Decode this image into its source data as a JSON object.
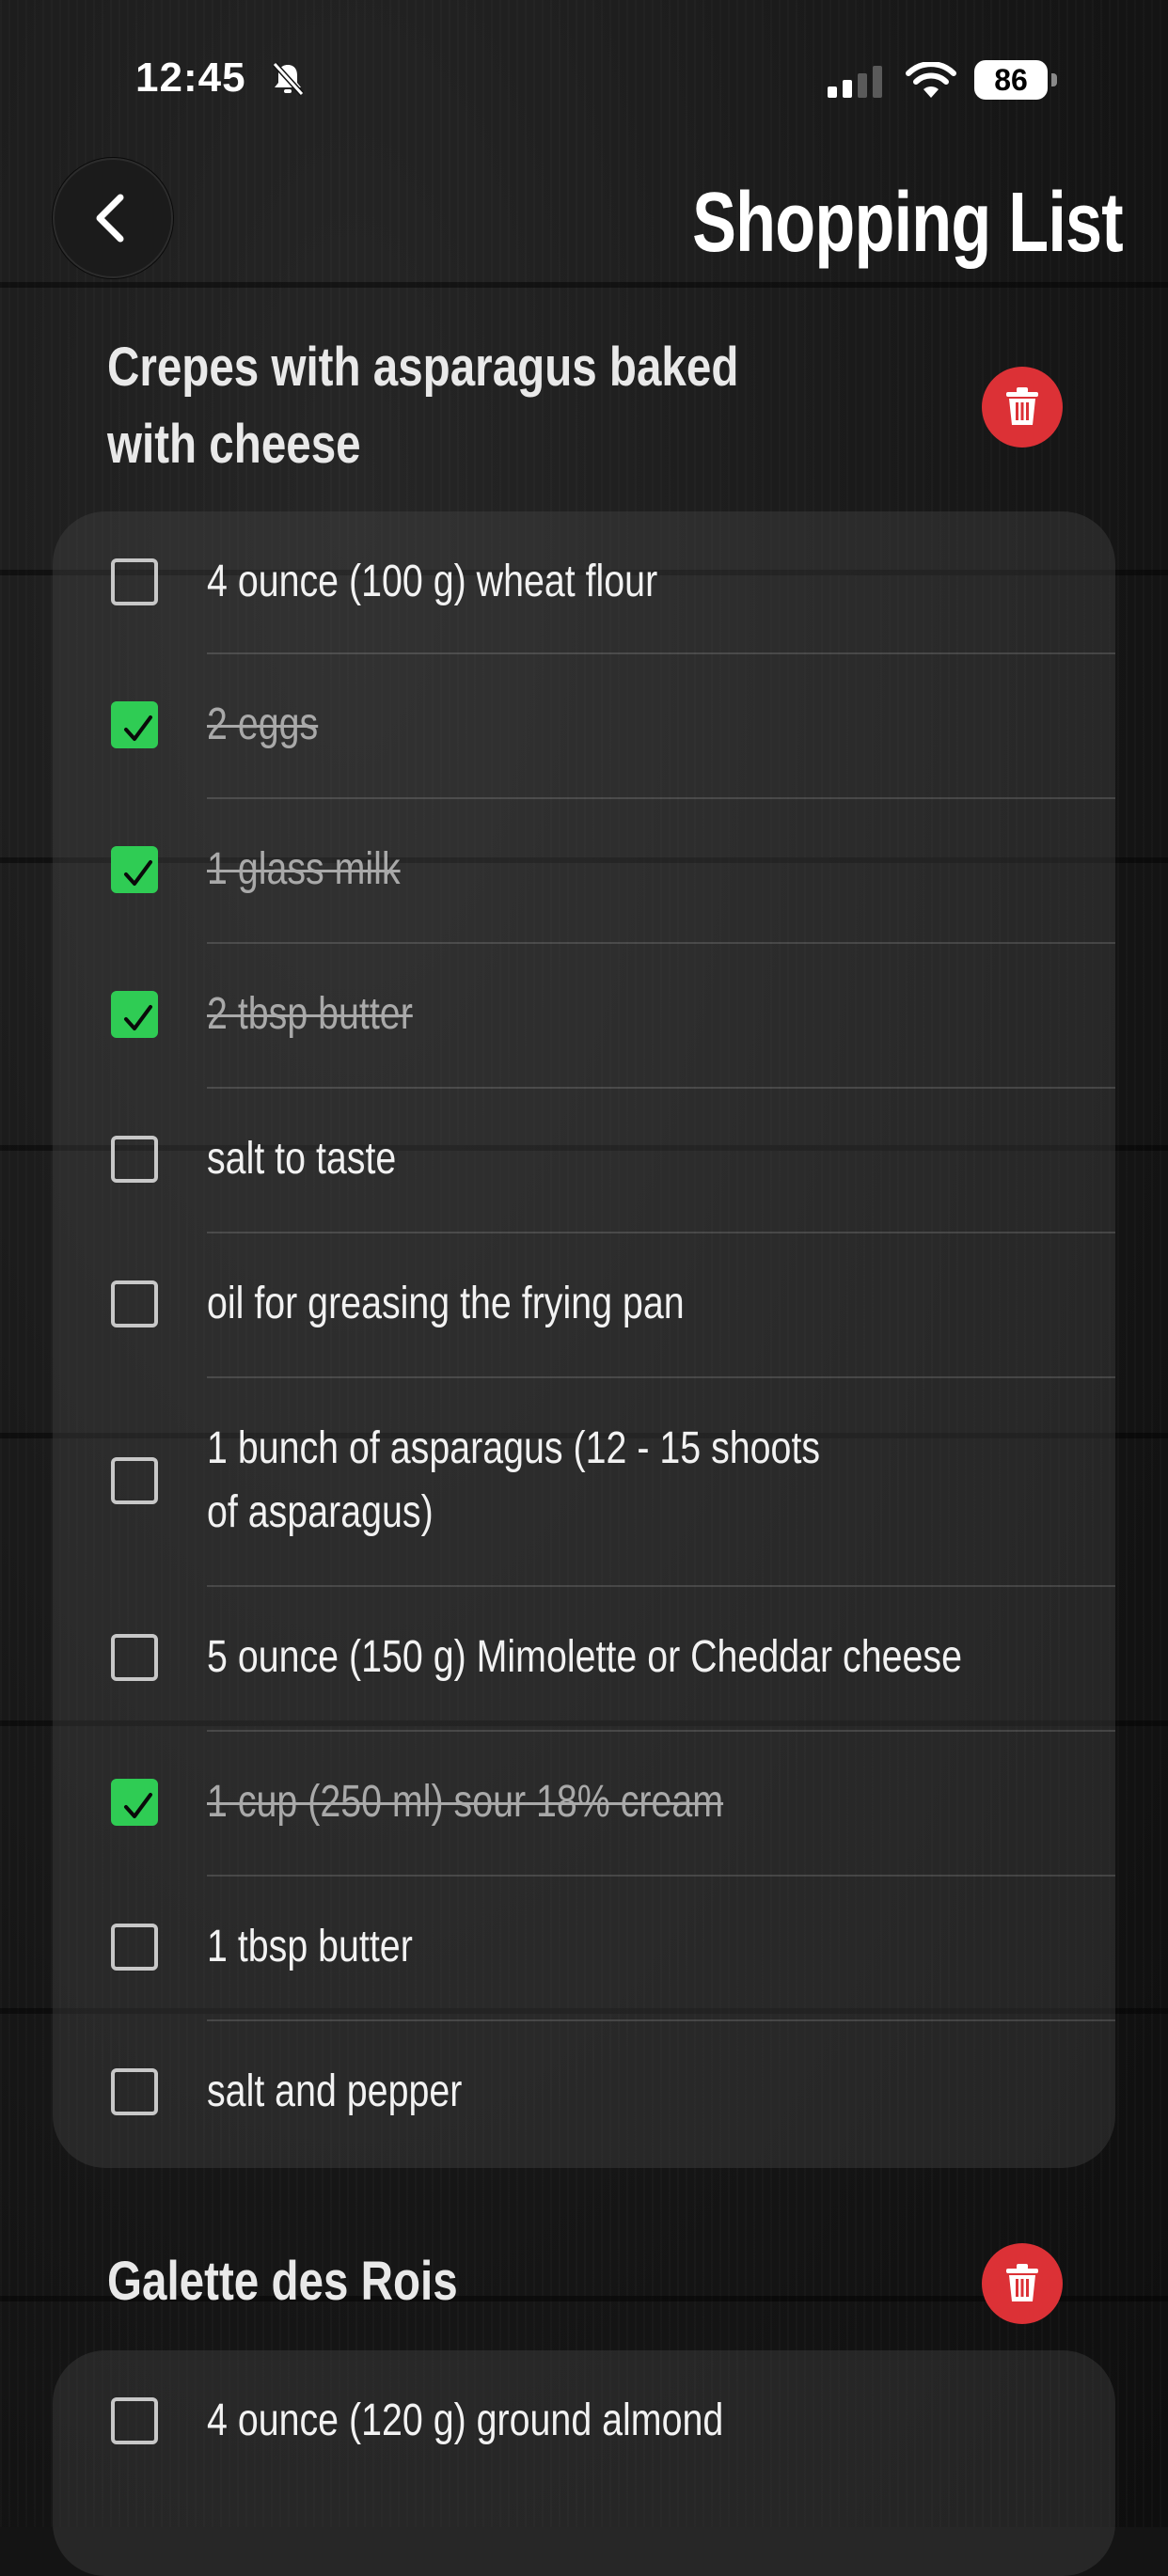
{
  "status_bar": {
    "time": "12:45",
    "battery": "86"
  },
  "header": {
    "title": "Shopping List"
  },
  "sections": [
    {
      "title_line1": "Crepes with asparagus baked",
      "title_line2": "with cheese",
      "items": [
        {
          "label": "4 ounce (100 g) wheat flour",
          "checked": false
        },
        {
          "label": "2 eggs",
          "checked": true
        },
        {
          "label": "1 glass milk",
          "checked": true
        },
        {
          "label": "2 tbsp butter",
          "checked": true
        },
        {
          "label": "salt to taste",
          "checked": false
        },
        {
          "label": "oil for greasing the frying pan",
          "checked": false
        },
        {
          "label_line1": "1 bunch of asparagus (12 - 15 shoots",
          "label_line2": "of asparagus)",
          "checked": false
        },
        {
          "label": "5 ounce (150 g) Mimolette or Cheddar cheese",
          "checked": false
        },
        {
          "label": "1 cup (250 ml) sour 18% cream",
          "checked": true
        },
        {
          "label": "1 tbsp butter",
          "checked": false
        },
        {
          "label": "salt and pepper",
          "checked": false
        }
      ]
    },
    {
      "title": "Galette des Rois",
      "items": [
        {
          "label": "4 ounce (120 g) ground almond",
          "checked": false
        }
      ]
    }
  ],
  "colors": {
    "check_green": "#2fcc54",
    "delete_red": "#dc3136"
  },
  "icons": [
    "bell-slash-icon",
    "signal-icon",
    "wifi-icon",
    "battery-icon",
    "chevron-left-icon",
    "trash-icon",
    "checkmark-icon"
  ]
}
